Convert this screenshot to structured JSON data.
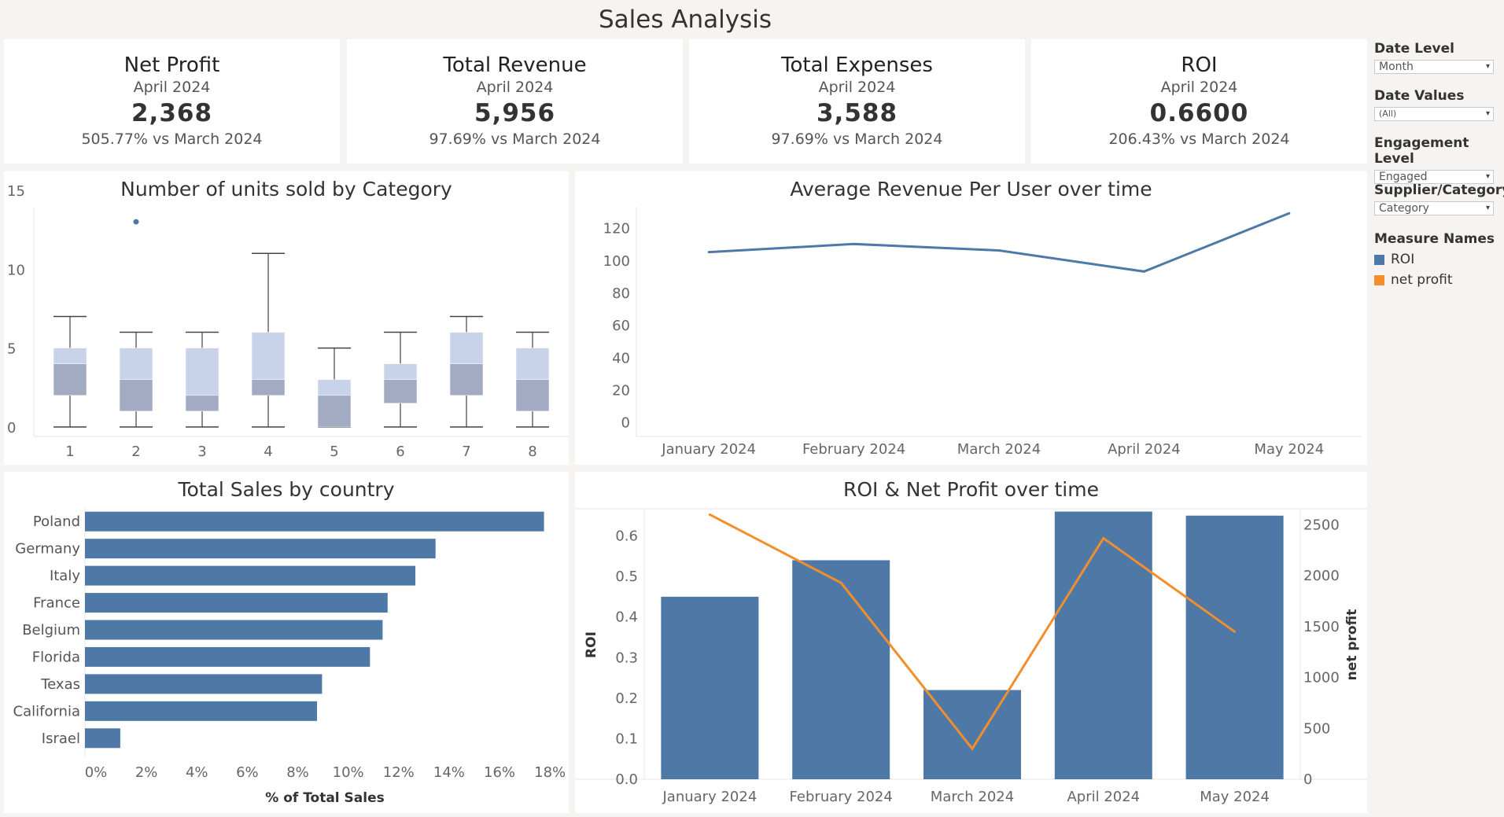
{
  "dashboard": {
    "title": "Sales Analysis"
  },
  "kpis": [
    {
      "title": "Net Profit",
      "period": "April 2024",
      "value": "2,368",
      "compare": "505.77% vs March 2024"
    },
    {
      "title": "Total Revenue",
      "period": "April 2024",
      "value": "5,956",
      "compare": "97.69% vs March 2024"
    },
    {
      "title": "Total Expenses",
      "period": "April 2024",
      "value": "3,588",
      "compare": "97.69% vs March 2024"
    },
    {
      "title": "ROI",
      "period": "April 2024",
      "value": "0.6600",
      "compare": "206.43% vs March 2024"
    }
  ],
  "filters": {
    "date_level": {
      "label": "Date Level",
      "value": "Month"
    },
    "date_values": {
      "label": "Date Values",
      "value": "(All)"
    },
    "engagement_level": {
      "label": "Engagement Level",
      "value": "Engaged"
    },
    "supplier_category": {
      "label": "Supplier/Category",
      "value": "Category"
    }
  },
  "legend": {
    "title": "Measure Names",
    "items": [
      {
        "label": "ROI",
        "color": "#4e79a7"
      },
      {
        "label": "net profit",
        "color": "#f28e2b"
      }
    ]
  },
  "colors": {
    "primary": "#4e79a7",
    "secondary": "#f28e2b",
    "box_light": "#c8d3ea",
    "box_dark": "#a2abc2"
  },
  "chart_data": [
    {
      "type": "box",
      "title": "Number of units sold by Category",
      "categories": [
        "1",
        "2",
        "3",
        "4",
        "5",
        "6",
        "7",
        "8"
      ],
      "boxes": [
        {
          "min": 0,
          "q1": 2,
          "median": 4,
          "q3": 5,
          "max": 7
        },
        {
          "min": 0,
          "q1": 1,
          "median": 3,
          "q3": 5,
          "max": 6
        },
        {
          "min": 0,
          "q1": 1,
          "median": 2,
          "q3": 5,
          "max": 6
        },
        {
          "min": 0,
          "q1": 2,
          "median": 3,
          "q3": 6,
          "max": 11
        },
        {
          "min": 0,
          "q1": 0,
          "median": 2,
          "q3": 3,
          "max": 5
        },
        {
          "min": 0,
          "q1": 1.5,
          "median": 3,
          "q3": 4,
          "max": 6
        },
        {
          "min": 0,
          "q1": 2,
          "median": 4,
          "q3": 6,
          "max": 7
        },
        {
          "min": 0,
          "q1": 1,
          "median": 3,
          "q3": 5,
          "max": 6
        }
      ],
      "outliers": [
        {
          "category": "2",
          "value": 13
        }
      ],
      "y_ticks": [
        0,
        5,
        10,
        15
      ],
      "ylim": [
        -0.4,
        13.9
      ]
    },
    {
      "type": "line",
      "title": "Average Revenue Per User over time",
      "x": [
        "January 2024",
        "February 2024",
        "March 2024",
        "April 2024",
        "May 2024"
      ],
      "values": [
        105,
        110,
        106,
        93,
        129
      ],
      "y_ticks": [
        0,
        20,
        40,
        60,
        80,
        100,
        120
      ],
      "ylim": [
        -7,
        133
      ]
    },
    {
      "type": "bar",
      "orientation": "horizontal",
      "title": "Total Sales by country",
      "xlabel": "% of Total Sales",
      "categories": [
        "Poland",
        "Germany",
        "Italy",
        "France",
        "Belgium",
        "Florida",
        "Texas",
        "California",
        "Israel"
      ],
      "values": [
        18.2,
        13.9,
        13.1,
        12.0,
        11.8,
        11.3,
        9.4,
        9.2,
        1.4
      ],
      "x_ticks": [
        "0%",
        "2%",
        "4%",
        "6%",
        "8%",
        "10%",
        "12%",
        "14%",
        "16%",
        "18%"
      ],
      "xlim": [
        0,
        18.4
      ]
    },
    {
      "type": "bar+line",
      "title": "ROI & Net Profit over time",
      "x": [
        "January 2024",
        "February 2024",
        "March 2024",
        "April 2024",
        "May 2024"
      ],
      "series": [
        {
          "name": "ROI",
          "type": "bar",
          "axis": "left",
          "values": [
            0.45,
            0.54,
            0.22,
            0.66,
            0.65
          ]
        },
        {
          "name": "net profit",
          "type": "line",
          "axis": "right",
          "values": [
            2600,
            1930,
            300,
            2368,
            1450
          ]
        }
      ],
      "ylabel_left": "ROI",
      "ylabel_right": "net profit",
      "y_left_ticks": [
        "0.0",
        "0.1",
        "0.2",
        "0.3",
        "0.4",
        "0.5",
        "0.6"
      ],
      "y_right_ticks": [
        "0",
        "500",
        "1000",
        "1500",
        "2000",
        "2500"
      ],
      "ylim_left": [
        0,
        0.665
      ],
      "ylim_right": [
        0,
        2650
      ]
    }
  ]
}
